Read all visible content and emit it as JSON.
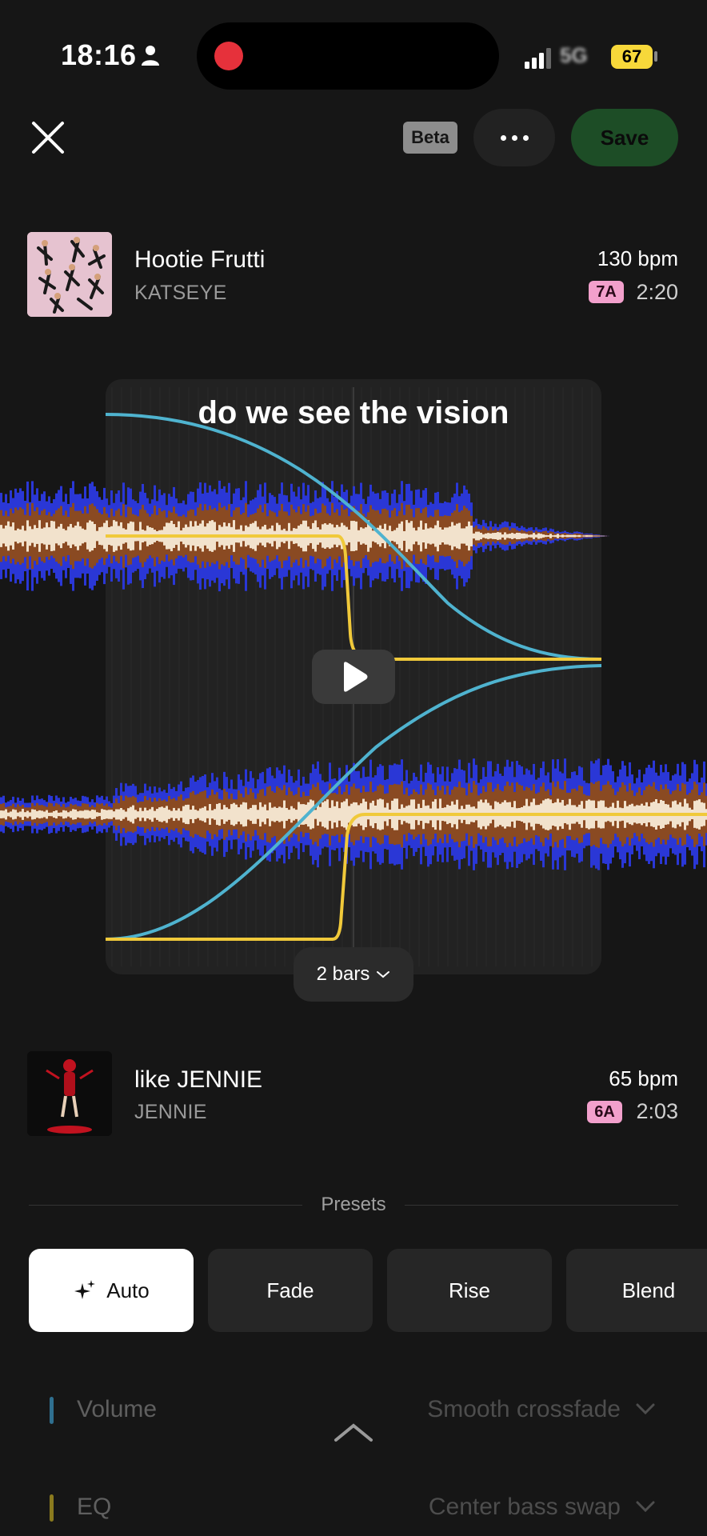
{
  "status_bar": {
    "time": "18:16",
    "network": "5G",
    "battery": "67"
  },
  "header": {
    "beta_label": "Beta",
    "save_label": "Save"
  },
  "track_top": {
    "title": "Hootie Frutti",
    "artist": "KATSEYE",
    "bpm": "130 bpm",
    "key": "7A",
    "duration": "2:20",
    "key_color": "#f2a0cc"
  },
  "transition": {
    "caption": "do we see the vision",
    "length_label": "2 bars"
  },
  "track_bottom": {
    "title": "like JENNIE",
    "artist": "JENNIE",
    "bpm": "65 bpm",
    "key": "6A",
    "duration": "2:03",
    "key_color": "#f2a0cc"
  },
  "presets": {
    "heading": "Presets",
    "items": [
      {
        "label": "Auto",
        "icon": "sparkle-icon",
        "active": true
      },
      {
        "label": "Fade",
        "active": false
      },
      {
        "label": "Rise",
        "active": false
      },
      {
        "label": "Blend",
        "active": false
      }
    ]
  },
  "settings": [
    {
      "label": "Volume",
      "value": "Smooth crossfade",
      "accent": "#2f6f8f"
    },
    {
      "label": "EQ",
      "value": "Center bass swap",
      "accent": "#8a7a1e"
    }
  ],
  "colors": {
    "save_bg": "#1d4d26",
    "curve_cyan": "#4fb3cf",
    "curve_yellow": "#f0c93a",
    "wave_blue": "#2a37d6",
    "wave_brown": "#8a4a22",
    "wave_cream": "#f2e2cc"
  }
}
